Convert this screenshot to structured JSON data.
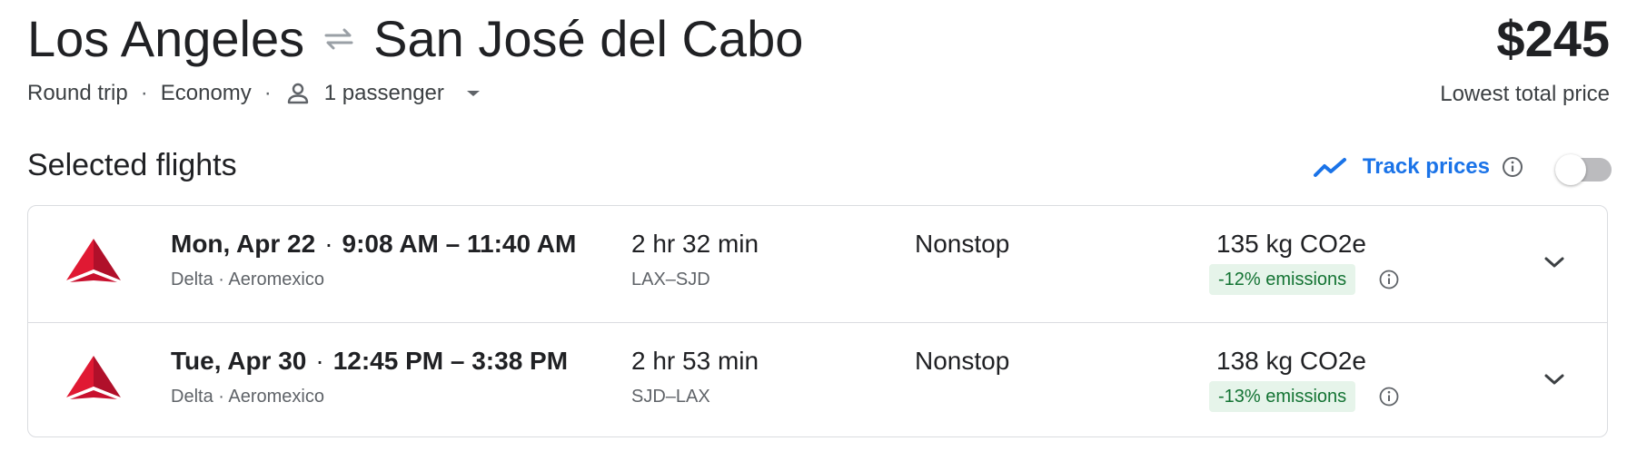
{
  "header": {
    "origin": "Los Angeles",
    "destination": "San José del Cabo",
    "swap_icon": "swap-arrows-icon",
    "price": "$245",
    "price_caption": "Lowest total price"
  },
  "trip_options": {
    "trip_type": "Round trip",
    "cabin": "Economy",
    "passengers": "1 passenger",
    "separator": "·"
  },
  "section": {
    "title": "Selected flights",
    "track_prices_label": "Track prices",
    "track_prices_enabled": false
  },
  "flights": [
    {
      "date": "Mon, Apr 22",
      "times": "9:08 AM – 11:40 AM",
      "airlines": "Delta · Aeromexico",
      "duration": "2 hr 32 min",
      "route": "LAX–SJD",
      "stops": "Nonstop",
      "emissions": "135 kg CO2e",
      "emissions_delta": "-12% emissions"
    },
    {
      "date": "Tue, Apr 30",
      "times": "12:45 PM – 3:38 PM",
      "airlines": "Delta · Aeromexico",
      "duration": "2 hr 53 min",
      "route": "SJD–LAX",
      "stops": "Nonstop",
      "emissions": "138 kg CO2e",
      "emissions_delta": "-13% emissions"
    }
  ],
  "colors": {
    "accent": "#1a73e8",
    "text_primary": "#202124",
    "text_secondary": "#5f6368",
    "emission_badge_bg": "#e6f4ea",
    "emission_badge_text": "#137333",
    "delta_red": "#e01933",
    "border": "#dadce0"
  }
}
